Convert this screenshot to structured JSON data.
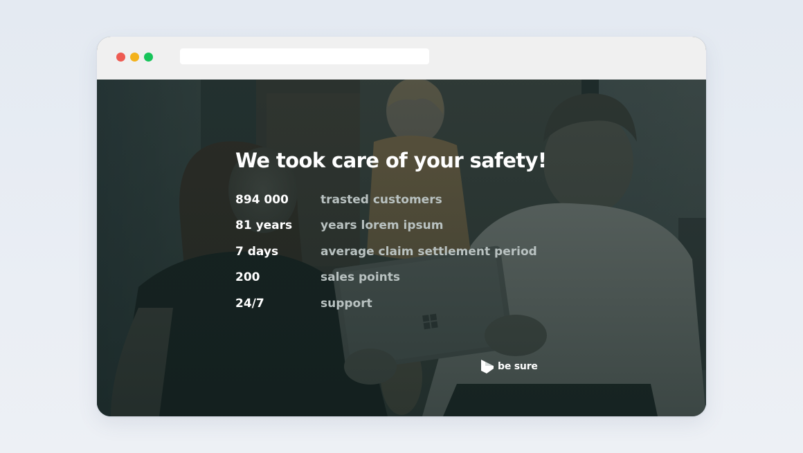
{
  "hero": {
    "title": "We took care of your safety!"
  },
  "stats": [
    {
      "value": "894 000",
      "label": "trasted customers"
    },
    {
      "value": "81 years",
      "label": "years lorem ipsum"
    },
    {
      "value": "7 days",
      "label": "average claim settlement period"
    },
    {
      "value": "200",
      "label": "sales points"
    },
    {
      "value": "24/7",
      "label": "support"
    }
  ],
  "brand": {
    "name": "be sure",
    "icon": "be-sure-logo-icon"
  },
  "colors": {
    "window_close": "#ee5b52",
    "window_minimize": "#f3b21c",
    "window_maximize": "#17c45a",
    "label_text": "#b9c2c1",
    "overlay": "#1d2c2a"
  }
}
